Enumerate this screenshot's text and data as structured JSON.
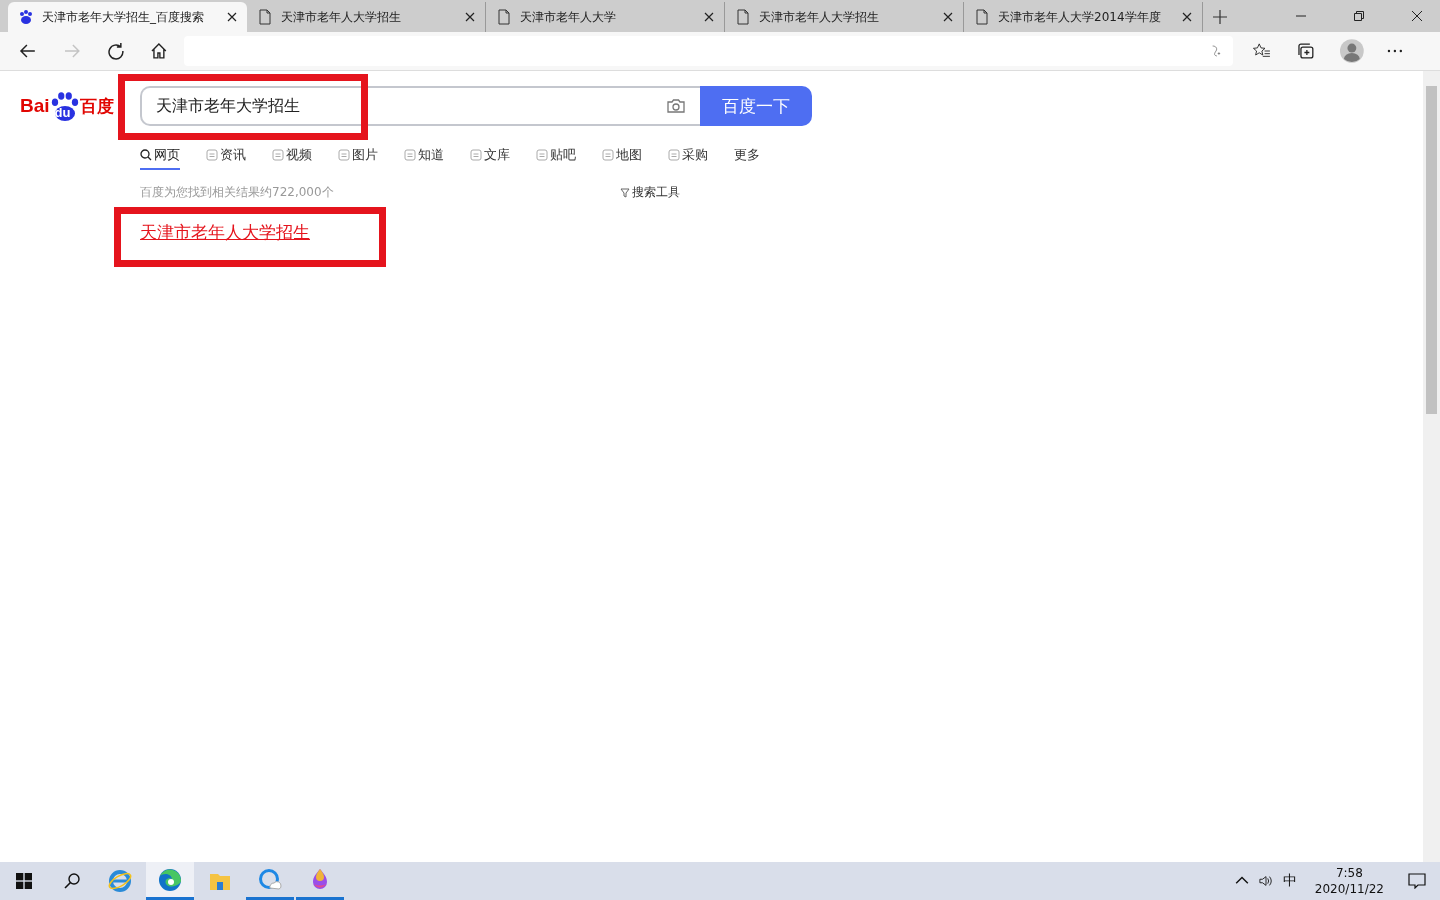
{
  "tabs": [
    {
      "title": "天津市老年大学招生_百度搜索",
      "kind": "paw",
      "selected": true
    },
    {
      "title": "天津市老年人大学招生",
      "kind": "page",
      "selected": false
    },
    {
      "title": "天津市老年人大学",
      "kind": "page",
      "selected": false
    },
    {
      "title": "天津市老年人大学招生",
      "kind": "page",
      "selected": false
    },
    {
      "title": "天津市老年人大学2014学年度",
      "kind": "page",
      "selected": false
    }
  ],
  "toolbar": {
    "forward_disabled": true
  },
  "logo": {
    "left": "Bai",
    "paw": "du",
    "right": "百度"
  },
  "search": {
    "value": "天津市老年大学招生",
    "button": "百度一下"
  },
  "nav": [
    {
      "label": "网页",
      "selected": true
    },
    {
      "label": "资讯",
      "selected": false
    },
    {
      "label": "视频",
      "selected": false
    },
    {
      "label": "图片",
      "selected": false
    },
    {
      "label": "知道",
      "selected": false
    },
    {
      "label": "文库",
      "selected": false
    },
    {
      "label": "贴吧",
      "selected": false
    },
    {
      "label": "地图",
      "selected": false
    },
    {
      "label": "采购",
      "selected": false
    },
    {
      "label": "更多",
      "selected": false
    }
  ],
  "result_count": "百度为您找到相关结果约722,000个",
  "search_tools": "搜索工具",
  "results": [
    {
      "title": "天津市老年人大学招生"
    }
  ],
  "taskbar": {
    "apps": [
      {
        "kind": "ie",
        "running": false,
        "selected": false
      },
      {
        "kind": "edge",
        "running": true,
        "selected": true
      },
      {
        "kind": "folder",
        "running": false,
        "selected": false
      },
      {
        "kind": "cloud",
        "running": true,
        "selected": false
      },
      {
        "kind": "flame",
        "running": true,
        "selected": false
      }
    ],
    "ime": "中",
    "time": "7:58",
    "date": "2020/11/22"
  }
}
